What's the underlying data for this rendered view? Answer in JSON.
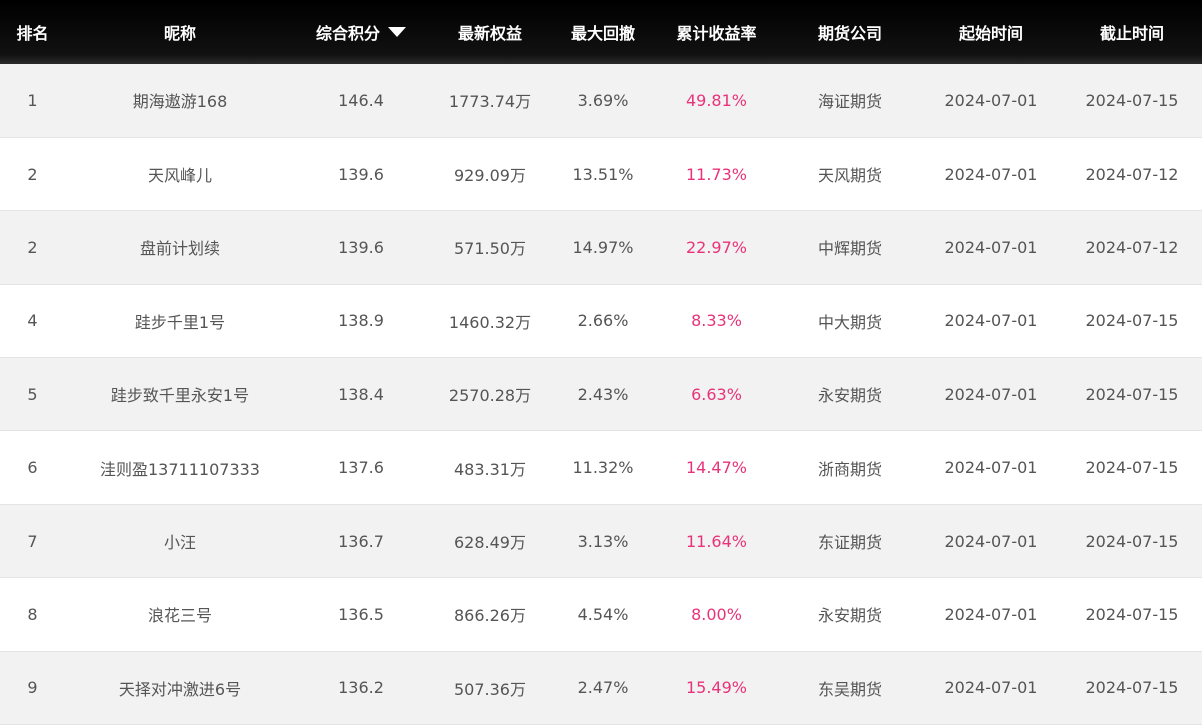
{
  "headers": {
    "rank": "排名",
    "nickname": "昵称",
    "score": "综合积分",
    "equity": "最新权益",
    "drawdown": "最大回撤",
    "return": "累计收益率",
    "broker": "期货公司",
    "start": "起始时间",
    "end": "截止时间"
  },
  "sort_icon": "caret-down-icon",
  "colors": {
    "header_bg": "#111111",
    "row_alt_bg": "#f2f2f2",
    "rate_color": "#e8337a",
    "text": "#555555"
  },
  "rows": [
    {
      "rank": "1",
      "nickname": "期海遨游168",
      "score": "146.4",
      "equity": "1773.74万",
      "drawdown": "3.69%",
      "return": "49.81%",
      "broker": "海证期货",
      "start": "2024-07-01",
      "end": "2024-07-15"
    },
    {
      "rank": "2",
      "nickname": "天风峰儿",
      "score": "139.6",
      "equity": "929.09万",
      "drawdown": "13.51%",
      "return": "11.73%",
      "broker": "天风期货",
      "start": "2024-07-01",
      "end": "2024-07-12"
    },
    {
      "rank": "2",
      "nickname": "盘前计划续",
      "score": "139.6",
      "equity": "571.50万",
      "drawdown": "14.97%",
      "return": "22.97%",
      "broker": "中辉期货",
      "start": "2024-07-01",
      "end": "2024-07-12"
    },
    {
      "rank": "4",
      "nickname": "跬步千里1号",
      "score": "138.9",
      "equity": "1460.32万",
      "drawdown": "2.66%",
      "return": "8.33%",
      "broker": "中大期货",
      "start": "2024-07-01",
      "end": "2024-07-15"
    },
    {
      "rank": "5",
      "nickname": "跬步致千里永安1号",
      "score": "138.4",
      "equity": "2570.28万",
      "drawdown": "2.43%",
      "return": "6.63%",
      "broker": "永安期货",
      "start": "2024-07-01",
      "end": "2024-07-15"
    },
    {
      "rank": "6",
      "nickname": "洼则盈13711107333",
      "score": "137.6",
      "equity": "483.31万",
      "drawdown": "11.32%",
      "return": "14.47%",
      "broker": "浙商期货",
      "start": "2024-07-01",
      "end": "2024-07-15"
    },
    {
      "rank": "7",
      "nickname": "小汪",
      "score": "136.7",
      "equity": "628.49万",
      "drawdown": "3.13%",
      "return": "11.64%",
      "broker": "东证期货",
      "start": "2024-07-01",
      "end": "2024-07-15"
    },
    {
      "rank": "8",
      "nickname": "浪花三号",
      "score": "136.5",
      "equity": "866.26万",
      "drawdown": "4.54%",
      "return": "8.00%",
      "broker": "永安期货",
      "start": "2024-07-01",
      "end": "2024-07-15"
    },
    {
      "rank": "9",
      "nickname": "天择对冲激进6号",
      "score": "136.2",
      "equity": "507.36万",
      "drawdown": "2.47%",
      "return": "15.49%",
      "broker": "东吴期货",
      "start": "2024-07-01",
      "end": "2024-07-15"
    }
  ]
}
